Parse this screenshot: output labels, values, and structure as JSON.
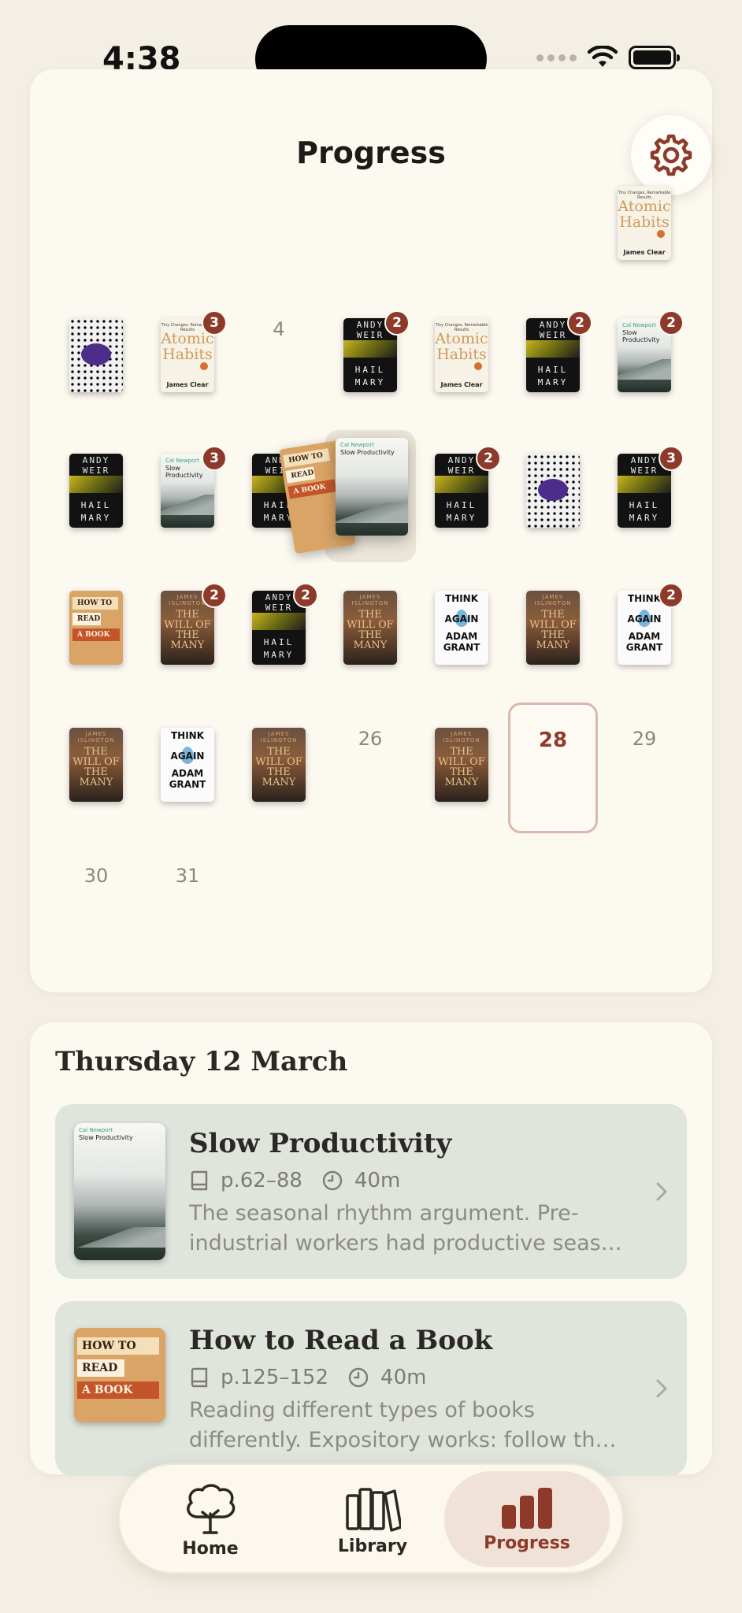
{
  "status_bar": {
    "time": "4:38"
  },
  "header": {
    "title": "Progress"
  },
  "calendar": {
    "days": [
      {
        "day": "4"
      },
      {
        "day": "26"
      },
      {
        "day": "28",
        "today": true
      },
      {
        "day": "29"
      },
      {
        "day": "30"
      },
      {
        "day": "31"
      }
    ],
    "badges": {
      "two": "2",
      "three": "3"
    }
  },
  "book_covers": {
    "hail_mary": {
      "author": "ANDY WEIR",
      "title1": "HAIL",
      "title2": "MARY"
    },
    "atomic_habits": {
      "tagline": "Tiny Changes, Remarkable Results",
      "title": "Atomic Habits",
      "author": "James Clear"
    },
    "slow_productivity": {
      "author": "Cal Newport",
      "title": "Slow Productivity"
    },
    "how_to_read": {
      "line1": "HOW TO",
      "line2": "READ",
      "line3": "A BOOK"
    },
    "will_of_many": {
      "author": "JAMES ISLINGTON",
      "title": "THE WILL OF THE MANY"
    },
    "think_again": {
      "line1": "THINK",
      "line2": "AGAIN",
      "line3": "ADAM",
      "line4": "GRANT"
    }
  },
  "detail": {
    "date": "Thursday 12 March",
    "sessions": [
      {
        "title": "Slow Productivity",
        "pages": "p.62–88",
        "duration": "40m",
        "note": "The seasonal rhythm argument. Pre-industrial workers had productive seas…"
      },
      {
        "title": "How to Read a Book",
        "pages": "p.125–152",
        "duration": "40m",
        "note": "Reading different types of books differently. Expository works: follow th…"
      }
    ]
  },
  "tabbar": {
    "tabs": [
      {
        "label": "Home"
      },
      {
        "label": "Library"
      },
      {
        "label": "Progress",
        "active": true
      }
    ]
  },
  "colors": {
    "accent": "#8e3a2b",
    "session_bg": "#dfe5dc",
    "card_bg": "#fcf9f1"
  }
}
